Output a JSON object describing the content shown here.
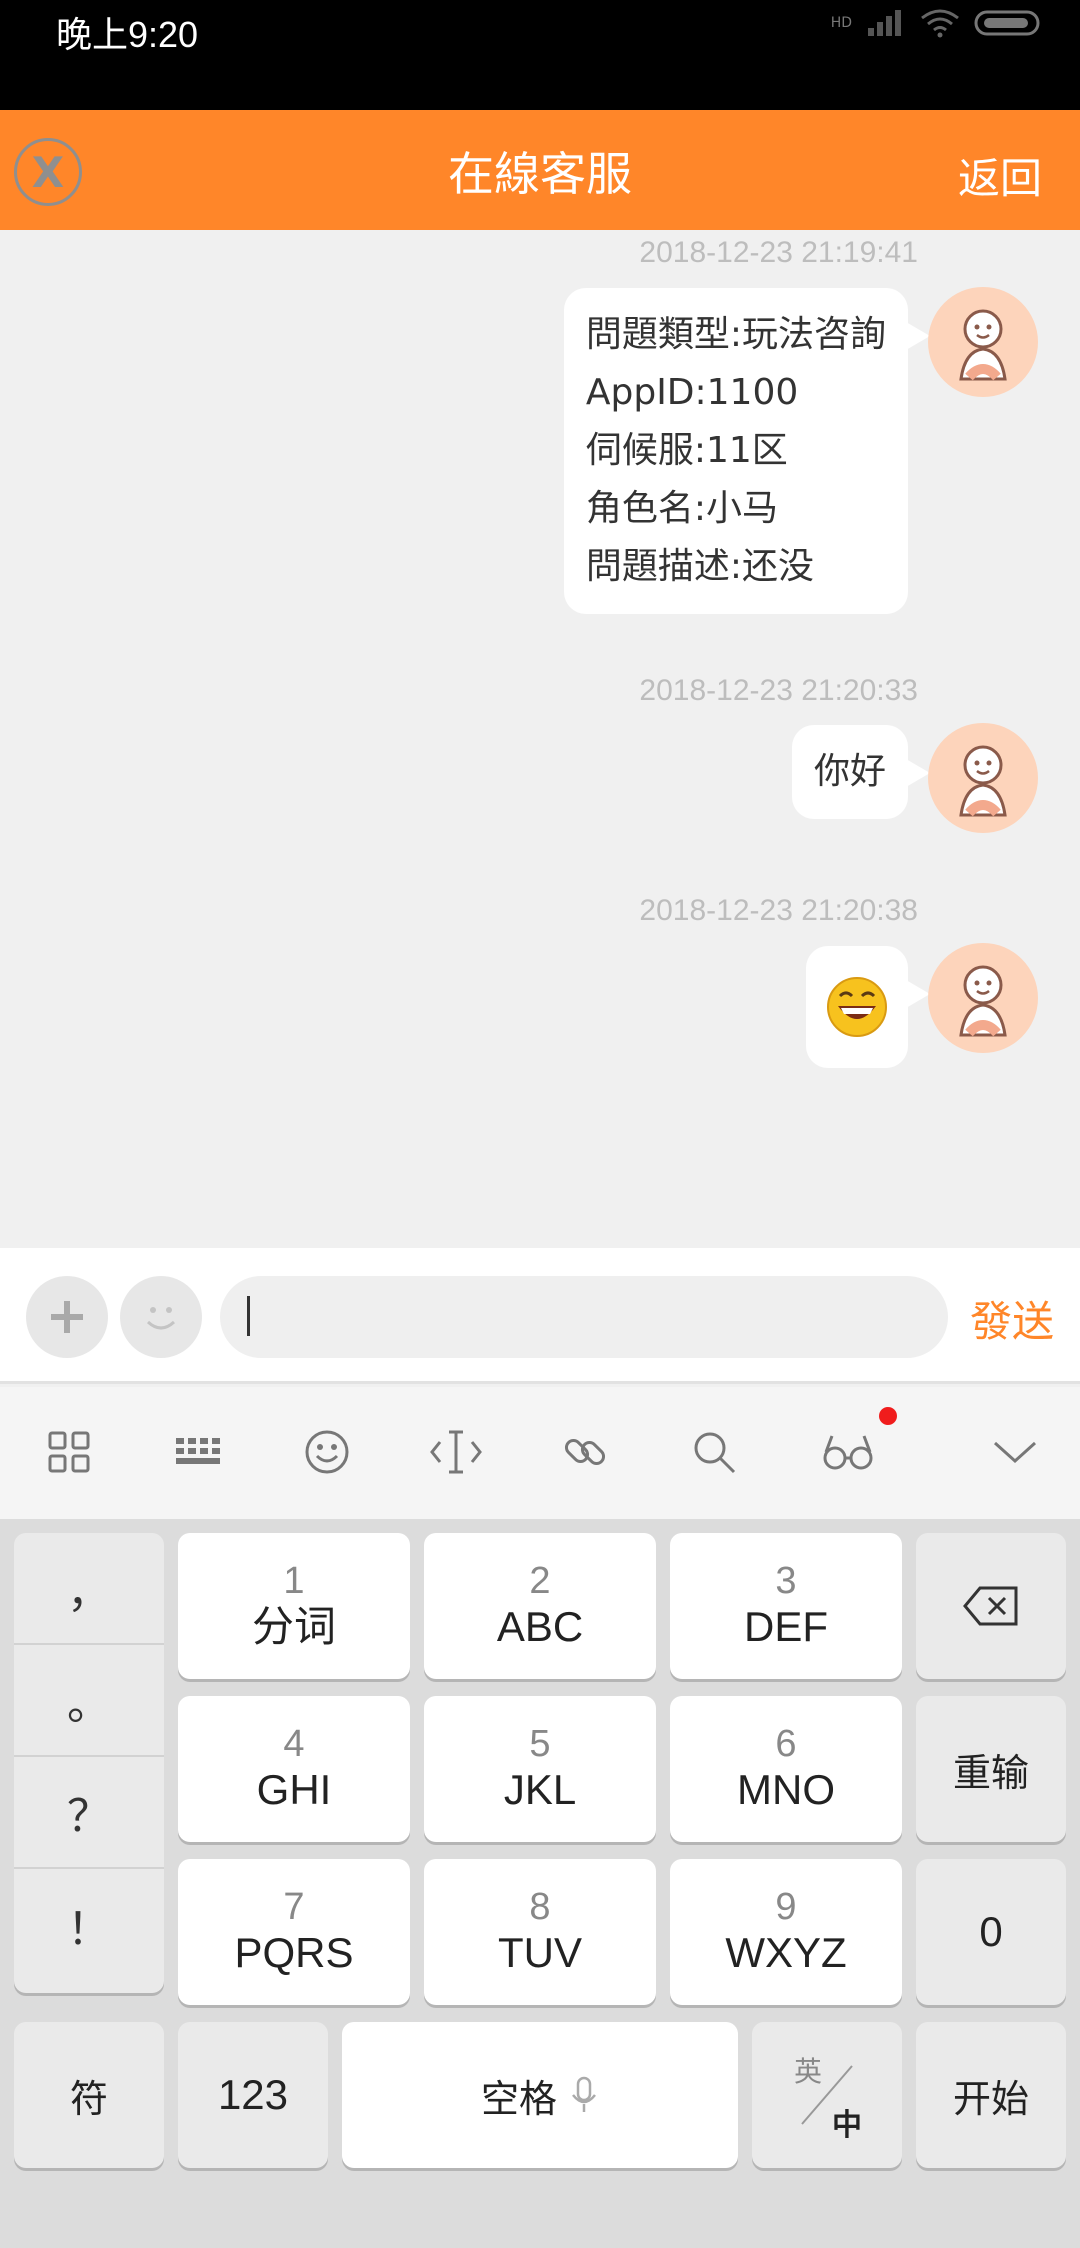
{
  "status_bar": {
    "time": "晚上9:20",
    "hd": "HD"
  },
  "header": {
    "title": "在線客服",
    "back_label": "返回",
    "close_glyph": "X"
  },
  "chat": {
    "messages": [
      {
        "timestamp": "2018-12-23 21:19:41",
        "lines": [
          "問題類型:玩法咨詢",
          "AppID:1100",
          "伺候服:11区",
          "角色名:小马",
          "問題描述:还没"
        ]
      },
      {
        "timestamp": "2018-12-23 21:20:33",
        "lines": [
          "你好"
        ]
      },
      {
        "timestamp": "2018-12-23 21:20:38",
        "emoji": "grinning-emoji"
      }
    ]
  },
  "input_bar": {
    "value": "",
    "send_label": "發送"
  },
  "keyboard": {
    "punctuation": [
      "，",
      "。",
      "？",
      "！"
    ],
    "keys": [
      {
        "num": "1",
        "letters": "分词"
      },
      {
        "num": "2",
        "letters": "ABC"
      },
      {
        "num": "3",
        "letters": "DEF"
      },
      {
        "num": "4",
        "letters": "GHI"
      },
      {
        "num": "5",
        "letters": "JKL"
      },
      {
        "num": "6",
        "letters": "MNO"
      },
      {
        "num": "7",
        "letters": "PQRS"
      },
      {
        "num": "8",
        "letters": "TUV"
      },
      {
        "num": "9",
        "letters": "WXYZ"
      }
    ],
    "reinput_label": "重输",
    "zero_label": "0",
    "symbol_label": "符",
    "numeric_label": "123",
    "space_label": "空格",
    "lang_en": "英",
    "lang_zh": "中",
    "start_label": "开始"
  },
  "colors": {
    "accent": "#ff8629",
    "avatar_bg": "#fdd4bb",
    "chat_bg": "#f0f0f0"
  }
}
